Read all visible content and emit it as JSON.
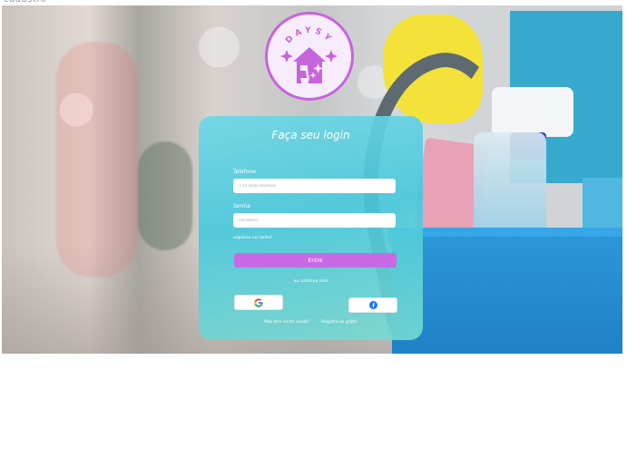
{
  "page_label": "cadastro",
  "brand": {
    "name": "DAYSY"
  },
  "login": {
    "title": "Faça seu login",
    "phone_label": "Telefone",
    "phone_placeholder": "+55 DDD telefone",
    "password_label": "Senha",
    "password_placeholder": "Password",
    "forgot_password": "esqueceu sua senha?",
    "enter_button": "Entre",
    "alt_login_text": "ou continue com",
    "social": [
      {
        "name": "Google",
        "icon": "google-icon"
      },
      {
        "name": "Facebook",
        "icon": "facebook-icon"
      }
    ],
    "no_account_text": "Não tem conta ainda?",
    "register_link": "Registre-se grátis"
  },
  "colors": {
    "accent_purple": "#c86ae6",
    "card_teal": "#52c8dc",
    "bucket_blue": "#1f7fc4"
  }
}
